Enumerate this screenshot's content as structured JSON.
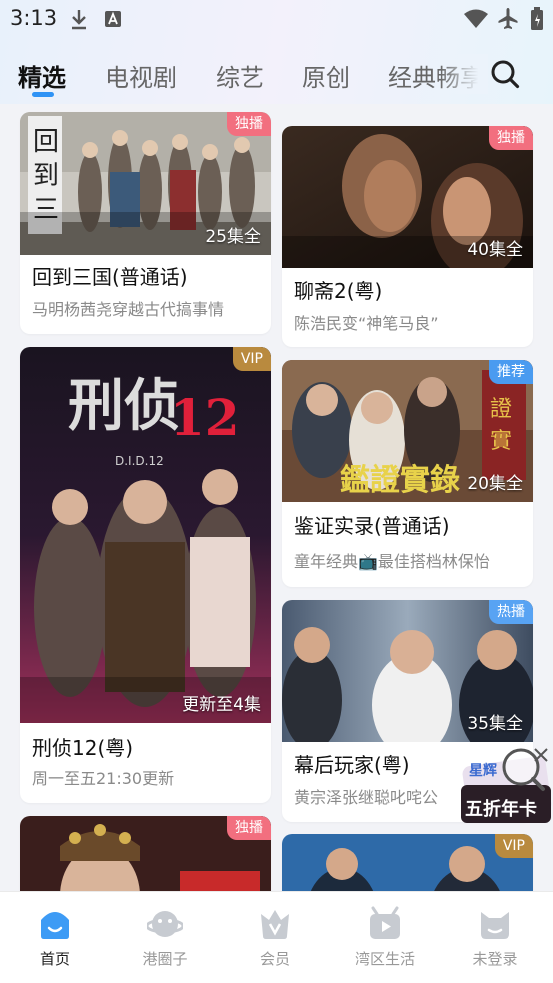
{
  "status_bar": {
    "time": "3:13"
  },
  "tabs": [
    {
      "label": "精选"
    },
    {
      "label": "电视剧"
    },
    {
      "label": "综艺"
    },
    {
      "label": "原创"
    },
    {
      "label": "经典畅享"
    }
  ],
  "cards": [
    {
      "title": "回到三国(普通话)",
      "desc": "马明杨茜尧穿越古代搞事情",
      "episodes": "25集全",
      "badge": "独播",
      "badge_color": "#f26f7f"
    },
    {
      "title": "聊斋2(粤)",
      "desc": "陈浩民变“神笔马良”",
      "episodes": "40集全",
      "badge": "独播",
      "badge_color": "#f26f7f"
    },
    {
      "title": "刑侦12(粤)",
      "desc": "周一至五21:30更新",
      "episodes": "更新至4集",
      "badge": "VIP",
      "badge_color": "#b98a3e",
      "poster_text": "刑侦",
      "poster_num": "12",
      "poster_sub": "D.I.D.12"
    },
    {
      "title": "鉴证实录(普通话)",
      "desc": "童年经典📺最佳搭档林保怡",
      "episodes": "20集全",
      "badge": "推荐",
      "badge_color": "#4a9bf0",
      "poster_text": "鑑證實錄"
    },
    {
      "title": "幕后玩家(粤)",
      "desc": "黄宗泽张继聪叱咤公",
      "episodes": "35集全",
      "badge": "热播",
      "badge_color": "#58a3f3"
    },
    {
      "badge": "独播",
      "badge_color": "#f26f7f"
    },
    {
      "badge": "VIP",
      "badge_color": "#b98a3e"
    }
  ],
  "bottom_nav": [
    {
      "label": "首页",
      "icon": "home-icon"
    },
    {
      "label": "港圈子",
      "icon": "planet-icon"
    },
    {
      "label": "会员",
      "icon": "vip-icon"
    },
    {
      "label": "湾区生活",
      "icon": "play-icon"
    },
    {
      "label": "未登录",
      "icon": "user-icon"
    }
  ],
  "float_ad": {
    "brand": "星辉",
    "text": "五折年卡"
  }
}
